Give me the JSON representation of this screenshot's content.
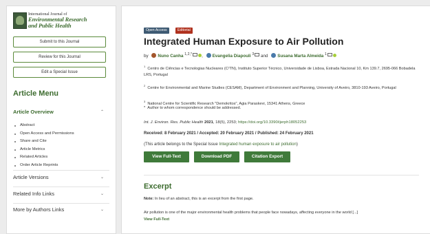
{
  "sidebar": {
    "journal": {
      "line1": "International Journal of",
      "line2": "Environmental Research",
      "line3": "and Public Health"
    },
    "buttons": [
      "Submit to this Journal",
      "Review for this Journal",
      "Edit a Special Issue"
    ],
    "menu_title": "Article Menu",
    "overview_title": "Article Overview",
    "overview_items": [
      "Abstract",
      "Open Access and Permissions",
      "Share and Cite",
      "Article Metrics",
      "Related Articles",
      "Order Article Reprints"
    ],
    "sections": [
      "Article Versions",
      "Related Info Links",
      "More by Authors Links"
    ]
  },
  "article": {
    "badges": [
      "Open Access",
      "Editorial"
    ],
    "title": "Integrated Human Exposure to Air Pollution",
    "by": "by",
    "authors": [
      {
        "name": "Nuno Canha",
        "sup": "1,2,*"
      },
      {
        "name": "Evangelia Diapouli",
        "sup": "3"
      },
      {
        "name": "Susana Marta Almeida",
        "sup": "1"
      }
    ],
    "and": "and",
    "affiliations": [
      {
        "num": "1",
        "text": "Centro de Ciências e Tecnologias Nucleares (C²TN), Instituto Superior Técnico, Universidade de Lisboa, Estrada Nacional 10, Km 139.7, 2695-066 Bobadela LRS, Portugal"
      },
      {
        "num": "2",
        "text": "Centre for Environmental and Marine Studies (CESAM), Department of Environment and Planning, University of Aveiro, 3810-193 Aveiro, Portugal"
      },
      {
        "num": "3",
        "text": "National Centre for Scientific Research \"Demokritos\", Agia Paraskevi, 15341 Athens, Greece"
      },
      {
        "num": "*",
        "text": "Author to whom correspondence should be addressed."
      }
    ],
    "citation": {
      "journal": "Int. J. Environ. Res. Public Health",
      "year": "2021",
      "rest": ", 18(5), 2253;",
      "doi": "https://doi.org/10.3390/ijerph18052253"
    },
    "dates": "Received: 8 February 2021 / Accepted: 20 February 2021 / Published: 24 February 2021",
    "special": {
      "prefix": "(This article belongs to the Special Issue",
      "link": "Integrated human exposure to air pollution",
      "suffix": ")"
    },
    "actions": [
      "View Full-Text",
      "Download PDF",
      "Citation Export"
    ],
    "excerpt": {
      "heading": "Excerpt",
      "note_label": "Note:",
      "note": "In lieu of an abstract, this is an excerpt from the first page.",
      "body": "Air pollution is one of the major environmental health problems that people face nowadays, affecting everyone in the world [...]",
      "link": "View Full-Text"
    }
  },
  "colors": {
    "accent": "#3c6b2e",
    "button": "#3f7a3a",
    "badge_open": "#3e5a73",
    "badge_editorial": "#b0321f"
  }
}
